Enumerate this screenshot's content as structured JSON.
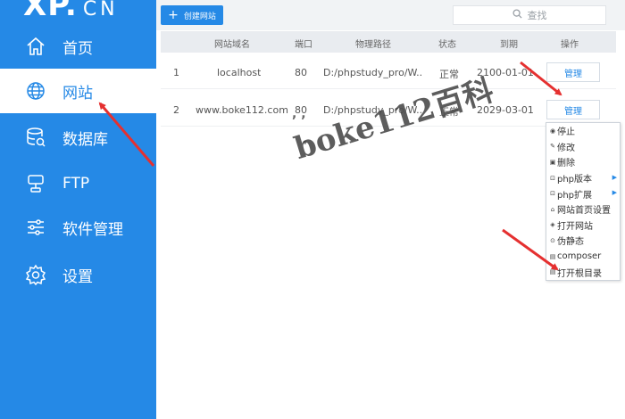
{
  "brand": {
    "xp": "XP.",
    "cn": "CN"
  },
  "sidebar": {
    "items": [
      {
        "label": "首页",
        "icon": "home-icon"
      },
      {
        "label": "网站",
        "icon": "globe-icon",
        "active": true
      },
      {
        "label": "数据库",
        "icon": "database-icon"
      },
      {
        "label": "FTP",
        "icon": "ftp-server-icon"
      },
      {
        "label": "软件管理",
        "icon": "sliders-icon"
      },
      {
        "label": "设置",
        "icon": "gear-icon"
      }
    ]
  },
  "toolbar": {
    "create_label": "创建网站",
    "search_placeholder": "查找"
  },
  "table": {
    "headers": [
      "网站域名",
      "端口",
      "物理路径",
      "状态",
      "到期",
      "操作"
    ],
    "rows": [
      {
        "index": "1",
        "domain": "localhost",
        "port": "80",
        "path": "D:/phpstudy_pro/W...",
        "status": "正常",
        "expiry": "2100-01-01",
        "action": "管理"
      },
      {
        "index": "2",
        "domain": "www.boke112.com",
        "port": "80",
        "path": "D:/phpstudy_pro/W...",
        "status": "正常",
        "expiry": "2029-03-01",
        "action": "管理"
      }
    ]
  },
  "context_menu": {
    "items": [
      {
        "icon": "stop-icon",
        "label": "停止"
      },
      {
        "icon": "edit-icon",
        "label": "修改"
      },
      {
        "icon": "trash-icon",
        "label": "删除"
      },
      {
        "icon": "php-version-icon",
        "label": "php版本",
        "submenu": true
      },
      {
        "icon": "php-extension-icon",
        "label": "php扩展",
        "submenu": true
      },
      {
        "icon": "homepage-settings-icon",
        "label": "网站首页设置"
      },
      {
        "icon": "open-site-icon",
        "label": "打开网站"
      },
      {
        "icon": "static-icon",
        "label": "伪静态"
      },
      {
        "icon": "composer-icon",
        "label": "composer"
      },
      {
        "icon": "folder-icon",
        "label": "打开根目录"
      }
    ]
  },
  "watermark": {
    "text": "boke112百科"
  },
  "colors": {
    "accent": "#2589e6",
    "arrow": "#e53030"
  }
}
